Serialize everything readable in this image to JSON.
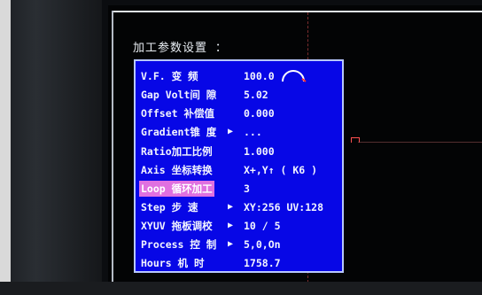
{
  "title": "加工参数设置 ：",
  "menu": [
    {
      "label": "V.F.  变  频",
      "arrow": "",
      "value": "100.0"
    },
    {
      "label": "Gap Volt间 隙",
      "arrow": "",
      "value": "5.02"
    },
    {
      "label": "Offset 补偿值",
      "arrow": "",
      "value": "0.000"
    },
    {
      "label": "Gradient锥 度",
      "arrow": "▶",
      "value": "..."
    },
    {
      "label": "Ratio加工比例",
      "arrow": "",
      "value": "1.000"
    },
    {
      "label": "Axis 坐标转换",
      "arrow": "",
      "value": "X+,Y↑ ( K6 )"
    },
    {
      "label": "Loop 循环加工",
      "arrow": "",
      "value": "3",
      "selected": true
    },
    {
      "label": "Step  步  速",
      "arrow": "▶",
      "value": "XY:256 UV:128"
    },
    {
      "label": "XYUV 拖板调校",
      "arrow": "▶",
      "value": "10 / 5"
    },
    {
      "label": "Process 控 制",
      "arrow": "▶",
      "value": "5,0,On"
    },
    {
      "label": "Hours  机  时",
      "arrow": "",
      "value": "1758.7"
    }
  ],
  "colors": {
    "panel_bg": "#0707e6",
    "panel_border": "#b8c8ff",
    "text": "#f2f4ff",
    "selected_bg": "#e070e0",
    "gauge_accent": "#ff3030"
  },
  "icons": [
    "frequency-gauge-icon"
  ]
}
